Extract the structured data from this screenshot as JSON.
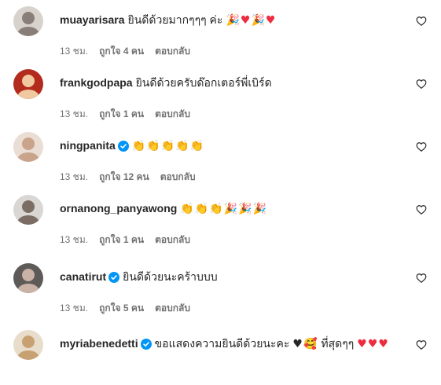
{
  "comments": [
    {
      "username": "muayarisara",
      "verified": false,
      "text": "ยินดีด้วยมากๆๆๆ ค่ะ",
      "emojis": [
        {
          "g": "🎉",
          "c": "party"
        },
        {
          "g": "♥",
          "c": "heart"
        },
        {
          "g": "🎉",
          "c": "party"
        },
        {
          "g": "♥",
          "c": "heart"
        }
      ],
      "time": "13 ชม.",
      "likes": "ถูกใจ 4 คน",
      "reply": "ตอบกลับ",
      "avatar": {
        "bg": "#d8d2cc",
        "fg": "#8a7f78"
      }
    },
    {
      "username": "frankgodpapa",
      "verified": false,
      "text": "ยินดีด้วยครับด๊อกเตอร์พี่เบิร์ด",
      "emojis": [],
      "time": "13 ชม.",
      "likes": "ถูกใจ 1 คน",
      "reply": "ตอบกลับ",
      "avatar": {
        "bg": "#b32b1d",
        "fg": "#f0c9a0"
      }
    },
    {
      "username": "ningpanita",
      "verified": true,
      "text": "",
      "emojis": [
        {
          "g": "👏",
          "c": "clap"
        },
        {
          "g": "👏",
          "c": "clap"
        },
        {
          "g": "👏",
          "c": "clap"
        },
        {
          "g": "👏",
          "c": "clap"
        },
        {
          "g": "👏",
          "c": "clap"
        }
      ],
      "time": "13 ชม.",
      "likes": "ถูกใจ 12 คน",
      "reply": "ตอบกลับ",
      "avatar": {
        "bg": "#e9ddd4",
        "fg": "#c9a38a"
      }
    },
    {
      "username": "ornanong_panyawong",
      "verified": false,
      "text": "",
      "emojis": [
        {
          "g": "👏",
          "c": "clap"
        },
        {
          "g": "👏",
          "c": "clap"
        },
        {
          "g": "👏",
          "c": "clap"
        },
        {
          "g": "🎉",
          "c": "party"
        },
        {
          "g": "🎉",
          "c": "party"
        },
        {
          "g": "🎉",
          "c": "party"
        }
      ],
      "time": "13 ชม.",
      "likes": "ถูกใจ 1 คน",
      "reply": "ตอบกลับ",
      "avatar": {
        "bg": "#d9d6d3",
        "fg": "#7b6d64"
      }
    },
    {
      "username": "canatirut",
      "verified": true,
      "text": "ยินดีด้วยนะคร้าบบบ",
      "emojis": [],
      "time": "13 ชม.",
      "likes": "ถูกใจ 5 คน",
      "reply": "ตอบกลับ",
      "avatar": {
        "bg": "#5e5a58",
        "fg": "#c9b2a6"
      }
    },
    {
      "username": "myriabenedetti",
      "verified": true,
      "text": "ขอแสดงความยินดีด้วยนะคะ",
      "emojis": [
        {
          "g": "♥",
          "c": "bheart"
        },
        {
          "g": "🥰",
          "c": "smile"
        }
      ],
      "text2": "ที่สุดๆๆ",
      "emojis2": [
        {
          "g": "♥",
          "c": "heart"
        },
        {
          "g": "♥",
          "c": "heart"
        },
        {
          "g": "♥",
          "c": "heart"
        }
      ],
      "time": "",
      "likes": "",
      "reply": "",
      "avatar": {
        "bg": "#e8dccb",
        "fg": "#c8a173"
      }
    }
  ],
  "colors": {
    "verified": "#0095f6",
    "meta": "#737373",
    "text": "#262626"
  },
  "icons": {
    "like": "heart-outline-icon",
    "verified": "verified-badge-icon"
  }
}
